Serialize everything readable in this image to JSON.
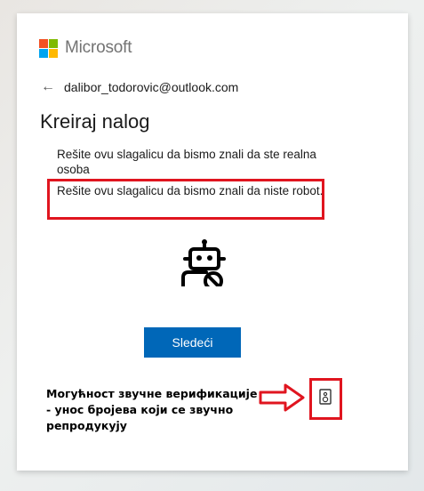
{
  "brand": {
    "name": "Microsoft"
  },
  "identity": {
    "email": "dalibor_todorovic@outlook.com"
  },
  "page": {
    "title": "Kreiraj nalog",
    "description": "Rešite ovu slagalicu da bismo znali da ste realna osoba",
    "description_highlighted": "Rešite ovu slagalicu da bismo znali da niste robot."
  },
  "actions": {
    "next_label": "Sledeći"
  },
  "annotation": {
    "text": "Могућност звучне верификације - унос бројева који се звучно репродукују"
  },
  "colors": {
    "accent": "#0067b8",
    "highlight": "#e0151f",
    "logo": [
      "#f25022",
      "#7fba00",
      "#00a4ef",
      "#ffb900"
    ]
  },
  "icons": {
    "back": "back-arrow-icon",
    "captcha": "robot-no-icon",
    "audio": "speaker-icon",
    "pointer": "right-arrow-icon"
  }
}
